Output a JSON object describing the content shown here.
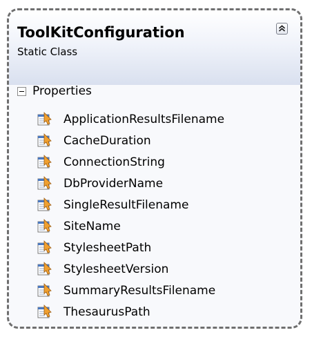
{
  "class_shape": {
    "name": "ToolKitConfiguration",
    "stereotype": "Static Class",
    "collapse_icon": "double-chevron-up-icon"
  },
  "section": {
    "label": "Properties",
    "expander_icon": "minus-box-icon"
  },
  "properties": [
    {
      "name": "ApplicationResultsFilename",
      "icon": "property-icon"
    },
    {
      "name": "CacheDuration",
      "icon": "property-icon"
    },
    {
      "name": "ConnectionString",
      "icon": "property-icon"
    },
    {
      "name": "DbProviderName",
      "icon": "property-icon"
    },
    {
      "name": "SingleResultFilename",
      "icon": "property-icon"
    },
    {
      "name": "SiteName",
      "icon": "property-icon"
    },
    {
      "name": "StylesheetPath",
      "icon": "property-icon"
    },
    {
      "name": "StylesheetVersion",
      "icon": "property-icon"
    },
    {
      "name": "SummaryResultsFilename",
      "icon": "property-icon"
    },
    {
      "name": "ThesaurusPath",
      "icon": "property-icon"
    }
  ],
  "colors": {
    "border": "#6f6f6f",
    "header_gradient_bottom": "#d9e0ef",
    "icon_orange": "#f0a030",
    "icon_blue": "#4a78c0"
  }
}
